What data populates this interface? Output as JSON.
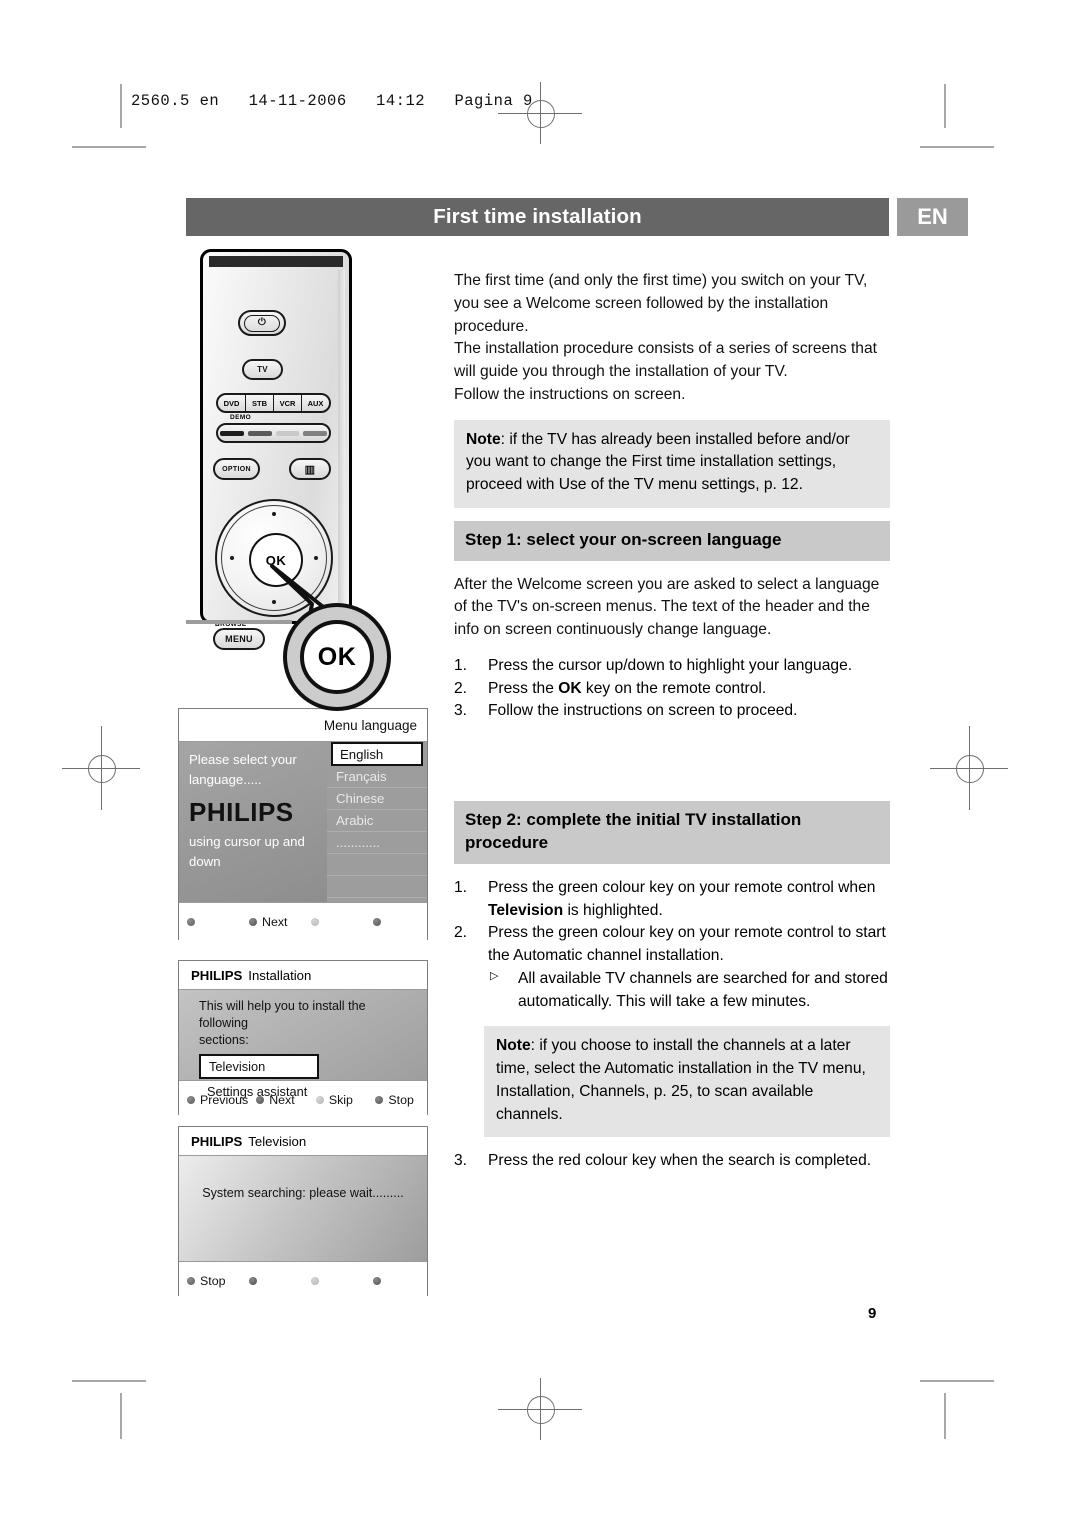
{
  "slug": "2560.5 en   14-11-2006   14:12   Pagina 9",
  "header": {
    "title": "First time installation",
    "language_badge": "EN"
  },
  "page_number": "9",
  "intro": {
    "p1": "The first time (and only the first time) you switch on your TV, you see a Welcome screen followed by the installation procedure.",
    "p2": "The installation procedure consists of a series of screens that will guide you through the installation of your TV.",
    "p3": "Follow the instructions on screen."
  },
  "note1": {
    "label": "Note",
    "text": ": if the TV has already been installed before and/or you want to change the First time installation settings, proceed with Use of the TV menu settings, p. 12."
  },
  "step1": {
    "title": "Step 1: select your on-screen language",
    "title_prefix": "Step 1",
    "title_rest": ": select your on-screen language",
    "body": "After the Welcome screen you are asked to select a language of the TV's on-screen menus. The text of the header and the info on screen continuously change language.",
    "items": [
      {
        "num": "1.",
        "text": "Press the cursor up/down to highlight your language."
      },
      {
        "num": "2.",
        "pre": "Press the ",
        "strong": "OK",
        "post": " key on the remote control."
      },
      {
        "num": "3.",
        "text": "Follow the instructions on screen to proceed."
      }
    ]
  },
  "step2": {
    "title_prefix": "Step 2",
    "title_rest": ": complete the initial TV installation procedure",
    "items": [
      {
        "num": "1.",
        "pre": "Press the green colour key on your remote control when ",
        "strong": "Television",
        "post": " is highlighted."
      },
      {
        "num": "2.",
        "text": "Press the green colour key on your remote control to start the Automatic channel installation."
      }
    ],
    "sub_bullet": {
      "marker": "▷",
      "text": "All available TV channels are searched for and stored automatically. This will take a few minutes."
    },
    "note2": {
      "label": "Note",
      "text": ": if you choose to install the channels at a later time, select the Automatic installation in the TV menu, Installation, Channels, p. 25, to scan available channels."
    },
    "item3": {
      "num": "3.",
      "text": "Press the red colour key when the search is completed."
    }
  },
  "remote": {
    "power_icon": "⏻",
    "tv_button": "TV",
    "mode_buttons": [
      "DVD",
      "STB",
      "VCR",
      "AUX"
    ],
    "demo_label": "DEMO",
    "option_button": "OPTION",
    "book_icon": "▥",
    "ok_button": "OK",
    "browse_label": "BROWSE",
    "menu_button": "MENU",
    "callout_ok": "OK"
  },
  "tv_screen_1": {
    "header": "Menu language",
    "left_line1": "Please select your",
    "left_line2": "language.....",
    "brand": "PHILIPS",
    "left_line3": "using cursor up and",
    "left_line4": "down",
    "languages": [
      "English",
      "Français",
      "Chinese",
      "Arabic",
      "............"
    ],
    "selected_language": "English",
    "footer": [
      "",
      "Next",
      "",
      ""
    ]
  },
  "tv_screen_2": {
    "brand": "PHILIPS",
    "header": "Installation",
    "body_line1": "This will help you to install the following",
    "body_line2": "sections:",
    "selected_item": "Television",
    "other_item": "Settings assistant",
    "footer": [
      "Previous",
      "Next",
      "Skip",
      "Stop"
    ]
  },
  "tv_screen_3": {
    "brand": "PHILIPS",
    "header": "Television",
    "status": "System searching: please wait.........",
    "footer": [
      "Stop",
      "",
      "",
      ""
    ]
  }
}
